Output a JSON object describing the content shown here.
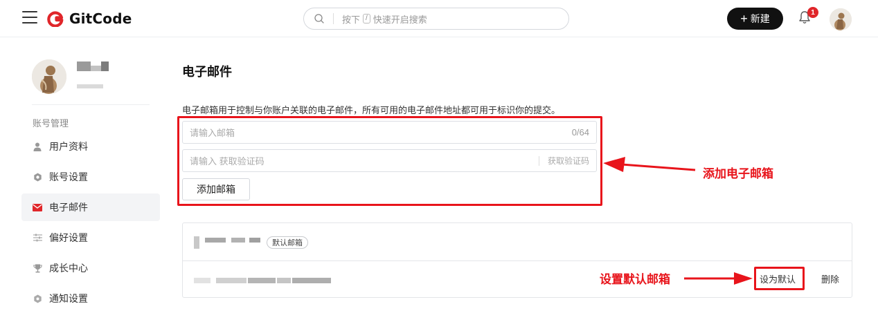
{
  "header": {
    "logo_text": "GitCode",
    "search_placeholder_prefix": "按下",
    "search_shortcut_key": "/",
    "search_placeholder_suffix": "快速开启搜索",
    "new_button_label": "新建",
    "notification_count": "1",
    "icons": [
      "menu-icon",
      "gitcode-logo",
      "search-icon",
      "plus-icon",
      "bell-icon",
      "avatar"
    ]
  },
  "sidebar": {
    "section_label": "账号管理",
    "items": [
      {
        "label": "用户资料",
        "icon": "user-icon",
        "active": false
      },
      {
        "label": "账号设置",
        "icon": "gear-icon",
        "active": false
      },
      {
        "label": "电子邮件",
        "icon": "mail-icon",
        "active": true
      },
      {
        "label": "偏好设置",
        "icon": "sliders-icon",
        "active": false
      },
      {
        "label": "成长中心",
        "icon": "trophy-icon",
        "active": false
      },
      {
        "label": "通知设置",
        "icon": "notification-settings-icon",
        "active": false
      }
    ]
  },
  "main": {
    "title": "电子邮件",
    "description": "电子邮箱用于控制与你账户关联的电子邮件，所有可用的电子邮件地址都可用于标识你的提交。",
    "email_input_placeholder": "请输入邮箱",
    "email_char_count": "0/64",
    "code_input_placeholder": "请输入 获取验证码",
    "get_code_label": "获取验证码",
    "add_email_button": "添加邮箱",
    "emails": [
      {
        "badge": "默认邮箱"
      },
      {
        "set_default_label": "设为默认",
        "delete_label": "删除"
      }
    ]
  },
  "annotations": {
    "add_email": "添加电子邮箱",
    "set_default": "设置默认邮箱",
    "color": "#e8141b"
  }
}
